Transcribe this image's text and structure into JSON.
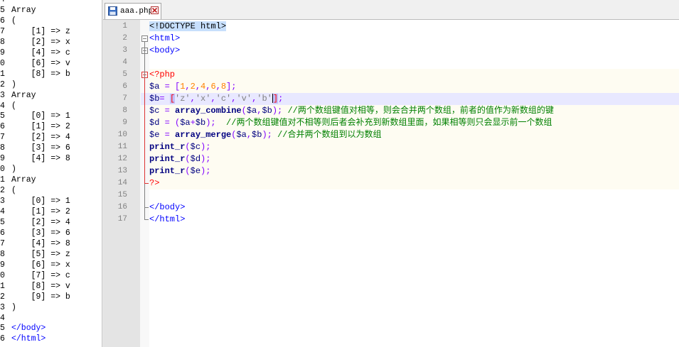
{
  "output_pane": {
    "lines": [
      {
        "num": "4",
        "text": ""
      },
      {
        "num": "5",
        "text": "Array"
      },
      {
        "num": "6",
        "text": "("
      },
      {
        "num": "7",
        "text": "    [1] => z"
      },
      {
        "num": "8",
        "text": "    [2] => x"
      },
      {
        "num": "9",
        "text": "    [4] => c"
      },
      {
        "num": "0",
        "text": "    [6] => v"
      },
      {
        "num": "1",
        "text": "    [8] => b"
      },
      {
        "num": "2",
        "text": ")"
      },
      {
        "num": "3",
        "text": "Array"
      },
      {
        "num": "4",
        "text": "("
      },
      {
        "num": "5",
        "text": "    [0] => 1"
      },
      {
        "num": "6",
        "text": "    [1] => 2"
      },
      {
        "num": "7",
        "text": "    [2] => 4"
      },
      {
        "num": "8",
        "text": "    [3] => 6"
      },
      {
        "num": "9",
        "text": "    [4] => 8"
      },
      {
        "num": "0",
        "text": ")"
      },
      {
        "num": "1",
        "text": "Array"
      },
      {
        "num": "2",
        "text": "("
      },
      {
        "num": "3",
        "text": "    [0] => 1"
      },
      {
        "num": "4",
        "text": "    [1] => 2"
      },
      {
        "num": "5",
        "text": "    [2] => 4"
      },
      {
        "num": "6",
        "text": "    [3] => 6"
      },
      {
        "num": "7",
        "text": "    [4] => 8"
      },
      {
        "num": "8",
        "text": "    [5] => z"
      },
      {
        "num": "9",
        "text": "    [6] => x"
      },
      {
        "num": "0",
        "text": "    [7] => c"
      },
      {
        "num": "1",
        "text": "    [8] => v"
      },
      {
        "num": "2",
        "text": "    [9] => b"
      },
      {
        "num": "3",
        "text": ")"
      },
      {
        "num": "4",
        "text": ""
      },
      {
        "num": "5",
        "text": "</body>"
      },
      {
        "num": "6",
        "text": "</html>"
      }
    ]
  },
  "editor": {
    "tab": {
      "label": "aaa.php",
      "icon": "save-icon",
      "close_icon": "close-icon"
    },
    "colors": {
      "tag": "#0000ff",
      "php": "#ff0000",
      "comment": "#008000",
      "number": "#ff8000",
      "gutter": "#e4e4e4"
    },
    "lines": [
      {
        "no": "1",
        "tokens": [
          {
            "c": "t-doctype",
            "t": "<!DOCTYPE html>"
          }
        ]
      },
      {
        "no": "2",
        "tokens": [
          {
            "c": "t-tag",
            "t": "<html>"
          }
        ]
      },
      {
        "no": "3",
        "tokens": [
          {
            "c": "t-tag",
            "t": "<body>"
          }
        ]
      },
      {
        "no": "4",
        "tokens": []
      },
      {
        "no": "5",
        "tokens": [
          {
            "c": "t-php",
            "t": "<?php"
          }
        ]
      },
      {
        "no": "6",
        "tokens": [
          {
            "c": "t-var",
            "t": "$a"
          },
          {
            "c": "t-plain",
            "t": " "
          },
          {
            "c": "t-op",
            "t": "="
          },
          {
            "c": "t-plain",
            "t": " "
          },
          {
            "c": "t-op",
            "t": "["
          },
          {
            "c": "t-num",
            "t": "1"
          },
          {
            "c": "t-op",
            "t": ","
          },
          {
            "c": "t-num",
            "t": "2"
          },
          {
            "c": "t-op",
            "t": ","
          },
          {
            "c": "t-num",
            "t": "4"
          },
          {
            "c": "t-op",
            "t": ","
          },
          {
            "c": "t-num",
            "t": "6"
          },
          {
            "c": "t-op",
            "t": ","
          },
          {
            "c": "t-num",
            "t": "8"
          },
          {
            "c": "t-op",
            "t": "];"
          }
        ]
      },
      {
        "no": "7",
        "tokens": [
          {
            "c": "t-var",
            "t": "$b"
          },
          {
            "c": "t-op",
            "t": "="
          },
          {
            "c": "t-plain",
            "t": " "
          },
          {
            "c": "t-brk-hl",
            "t": "["
          },
          {
            "c": "t-str",
            "t": "'z'"
          },
          {
            "c": "t-op",
            "t": ","
          },
          {
            "c": "t-str",
            "t": "'x'"
          },
          {
            "c": "t-op",
            "t": ","
          },
          {
            "c": "t-str",
            "t": "'c'"
          },
          {
            "c": "t-op",
            "t": ","
          },
          {
            "c": "t-str",
            "t": "'v'"
          },
          {
            "c": "t-op",
            "t": ","
          },
          {
            "c": "t-str",
            "t": "'b'"
          },
          {
            "c": "caret",
            "t": ""
          },
          {
            "c": "t-brk-hl",
            "t": "]"
          },
          {
            "c": "t-op",
            "t": ";"
          }
        ]
      },
      {
        "no": "8",
        "tokens": [
          {
            "c": "t-var",
            "t": "$c"
          },
          {
            "c": "t-plain",
            "t": " "
          },
          {
            "c": "t-op",
            "t": "="
          },
          {
            "c": "t-plain",
            "t": " "
          },
          {
            "c": "t-fn",
            "t": "array_combine"
          },
          {
            "c": "t-op",
            "t": "("
          },
          {
            "c": "t-var",
            "t": "$a"
          },
          {
            "c": "t-op",
            "t": ","
          },
          {
            "c": "t-var",
            "t": "$b"
          },
          {
            "c": "t-op",
            "t": ");"
          },
          {
            "c": "t-plain",
            "t": " "
          },
          {
            "c": "t-cmt",
            "t": "//两个数组键值对相等，则会合并两个数组，前者的值作为新数组的键"
          }
        ]
      },
      {
        "no": "9",
        "tokens": [
          {
            "c": "t-var",
            "t": "$d"
          },
          {
            "c": "t-plain",
            "t": " "
          },
          {
            "c": "t-op",
            "t": "="
          },
          {
            "c": "t-plain",
            "t": " "
          },
          {
            "c": "t-op",
            "t": "("
          },
          {
            "c": "t-var",
            "t": "$a"
          },
          {
            "c": "t-op",
            "t": "+"
          },
          {
            "c": "t-var",
            "t": "$b"
          },
          {
            "c": "t-op",
            "t": ");"
          },
          {
            "c": "t-plain",
            "t": "  "
          },
          {
            "c": "t-cmt",
            "t": "//两个数组键值对不相等则后者会补充到新数组里面，如果相等则只会显示前一个数组"
          }
        ]
      },
      {
        "no": "10",
        "tokens": [
          {
            "c": "t-var",
            "t": "$e"
          },
          {
            "c": "t-plain",
            "t": " "
          },
          {
            "c": "t-op",
            "t": "="
          },
          {
            "c": "t-plain",
            "t": " "
          },
          {
            "c": "t-fn",
            "t": "array_merge"
          },
          {
            "c": "t-op",
            "t": "("
          },
          {
            "c": "t-var",
            "t": "$a"
          },
          {
            "c": "t-op",
            "t": ","
          },
          {
            "c": "t-var",
            "t": "$b"
          },
          {
            "c": "t-op",
            "t": ");"
          },
          {
            "c": "t-plain",
            "t": " "
          },
          {
            "c": "t-cmt",
            "t": "//合并两个数组到以为数组"
          }
        ]
      },
      {
        "no": "11",
        "tokens": [
          {
            "c": "t-fn",
            "t": "print_r"
          },
          {
            "c": "t-op",
            "t": "("
          },
          {
            "c": "t-var",
            "t": "$c"
          },
          {
            "c": "t-op",
            "t": ");"
          }
        ]
      },
      {
        "no": "12",
        "tokens": [
          {
            "c": "t-fn",
            "t": "print_r"
          },
          {
            "c": "t-op",
            "t": "("
          },
          {
            "c": "t-var",
            "t": "$d"
          },
          {
            "c": "t-op",
            "t": ");"
          }
        ]
      },
      {
        "no": "13",
        "tokens": [
          {
            "c": "t-fn",
            "t": "print_r"
          },
          {
            "c": "t-op",
            "t": "("
          },
          {
            "c": "t-var",
            "t": "$e"
          },
          {
            "c": "t-op",
            "t": ");"
          }
        ]
      },
      {
        "no": "14",
        "tokens": [
          {
            "c": "t-php",
            "t": "?>"
          }
        ]
      },
      {
        "no": "15",
        "tokens": []
      },
      {
        "no": "16",
        "tokens": [
          {
            "c": "t-tag",
            "t": "</body>"
          }
        ]
      },
      {
        "no": "17",
        "tokens": [
          {
            "c": "t-tag",
            "t": "</html>"
          }
        ]
      }
    ]
  }
}
